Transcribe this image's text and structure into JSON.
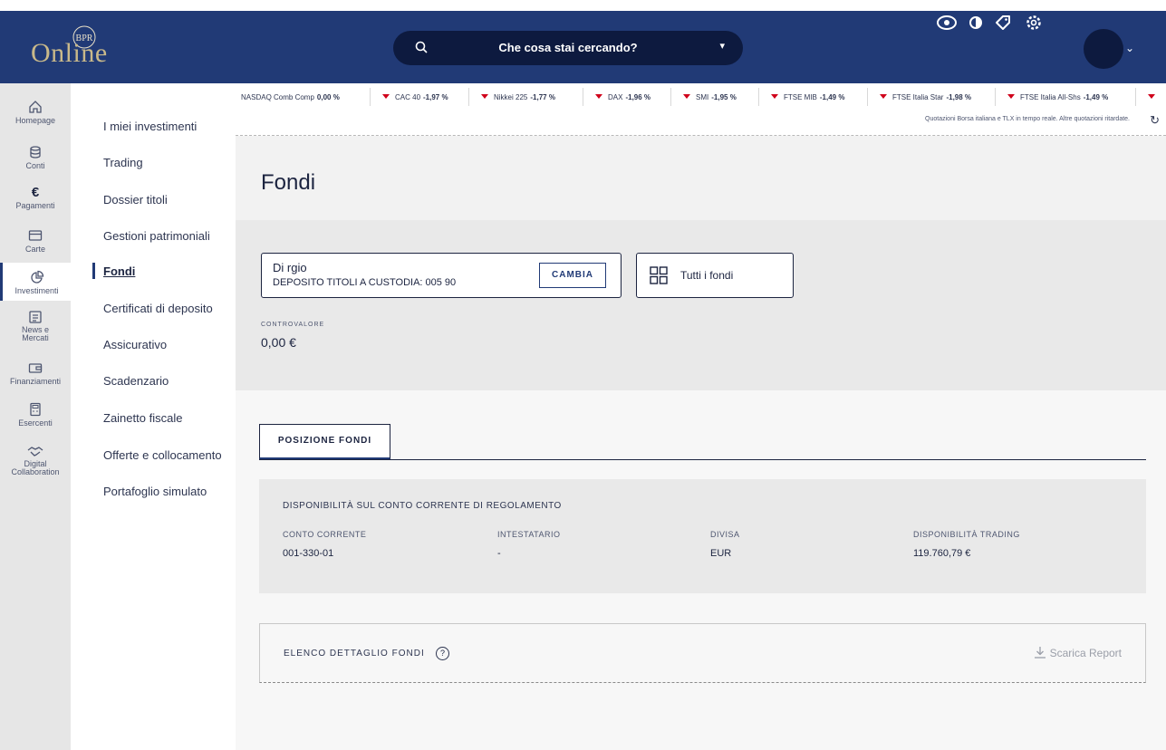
{
  "header": {
    "logo_mark": "BPR",
    "logo_text": "Online",
    "search_placeholder": "Che cosa stai cercando?"
  },
  "rail": [
    {
      "label": "Homepage",
      "icon": "home-icon"
    },
    {
      "label": "Conti",
      "icon": "coins-icon"
    },
    {
      "label": "Pagamenti",
      "icon": "euro-icon"
    },
    {
      "label": "Carte",
      "icon": "card-icon"
    },
    {
      "label": "Investimenti",
      "icon": "pie-chart-icon"
    },
    {
      "label": "News e Mercati",
      "icon": "news-icon"
    },
    {
      "label": "Finanziamenti",
      "icon": "wallet-icon"
    },
    {
      "label": "Esercenti",
      "icon": "terminal-icon"
    },
    {
      "label": "Digital Collaboration",
      "icon": "handshake-icon"
    }
  ],
  "subnav": [
    "I miei investimenti",
    "Trading",
    "Dossier titoli",
    "Gestioni patrimoniali",
    "Fondi",
    "Certificati di deposito",
    "Assicurativo",
    "Scadenzario",
    "Zainetto fiscale",
    "Offerte e collocamento",
    "Portafoglio simulato"
  ],
  "ticker": [
    {
      "name": "NASDAQ Comb Comp",
      "value": "0,00 %",
      "down": false
    },
    {
      "name": "CAC 40",
      "value": "-1,97 %",
      "down": true
    },
    {
      "name": "Nikkei 225",
      "value": "-1,77 %",
      "down": true
    },
    {
      "name": "DAX",
      "value": "-1,96 %",
      "down": true
    },
    {
      "name": "SMI",
      "value": "-1,95 %",
      "down": true
    },
    {
      "name": "FTSE MIB",
      "value": "-1,49 %",
      "down": true
    },
    {
      "name": "FTSE Italia Star",
      "value": "-1,98 %",
      "down": true
    },
    {
      "name": "FTSE Italia All-Shs",
      "value": "-1,49 %",
      "down": true
    }
  ],
  "ticker_note": "Quotazioni Borsa italiana e TLX in tempo reale. Altre quotazioni ritardate.",
  "page": {
    "title": "Fondi",
    "deposit_name": "Di         rgio",
    "deposit_sub": "DEPOSITO TITOLI A CUSTODIA: 005      90",
    "cambia": "CAMBIA",
    "tutti": "Tutti i fondi",
    "controvalore_label": "CONTROVALORE",
    "controvalore_value": "0,00 €"
  },
  "tabs": [
    "POSIZIONE FONDI"
  ],
  "regolamento": {
    "title": "DISPONIBILITÀ SUL CONTO CORRENTE DI REGOLAMENTO",
    "cols": [
      {
        "label": "CONTO CORRENTE",
        "value": "001-330-01"
      },
      {
        "label": "INTESTATARIO",
        "value": "-"
      },
      {
        "label": "DIVISA",
        "value": "EUR"
      },
      {
        "label": "DISPONIBILITÀ TRADING",
        "value": "119.760,79 €"
      }
    ]
  },
  "elenco": {
    "title": "ELENCO DETTAGLIO FONDI",
    "help": "?",
    "scarica": "Scarica Report"
  }
}
